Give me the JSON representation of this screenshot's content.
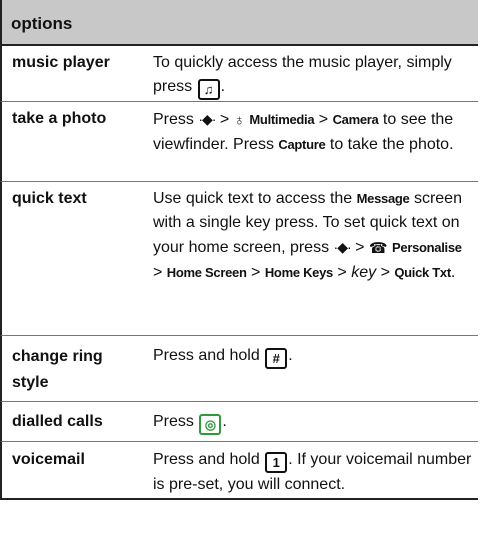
{
  "header": {
    "title": "options"
  },
  "rows": [
    {
      "term": "music player",
      "desc": {
        "t1": "To quickly access the music player, simply press",
        "key": "♫",
        "t2": "."
      }
    },
    {
      "term": "take a photo",
      "desc": {
        "t1": "Press",
        "nav": "·◆·",
        "gt1": ">",
        "icon": "♁",
        "m1": "Multimedia",
        "gt2": ">",
        "m2": "Camera",
        "t2": "to see the viewfinder. Press",
        "m3": "Capture",
        "t3": "to take the photo."
      }
    },
    {
      "term": "quick text",
      "desc": {
        "t1": "Use quick text to access the",
        "m1": "Message",
        "t2": "screen with a single key press. To set quick text on your home screen, press",
        "nav": "·◆·",
        "gt1": ">",
        "icon": "☎",
        "m2": "Personalise",
        "gt2": ">",
        "m3": "Home Screen",
        "gt3": ">",
        "m4": "Home Keys",
        "gt4": ">",
        "key_italic": "key",
        "gt5": ">",
        "m5": "Quick Txt",
        "t3": "."
      }
    },
    {
      "term": "change ring style",
      "desc": {
        "t1": "Press and hold",
        "key": "#",
        "t2": "."
      }
    },
    {
      "term": "dialled calls",
      "desc": {
        "t1": "Press",
        "key": "◎",
        "t2": "."
      }
    },
    {
      "term": "voicemail",
      "desc": {
        "t1": "Press and hold",
        "key": "1",
        "t2": ". If your voicemail number is pre-set, you will connect."
      }
    }
  ]
}
